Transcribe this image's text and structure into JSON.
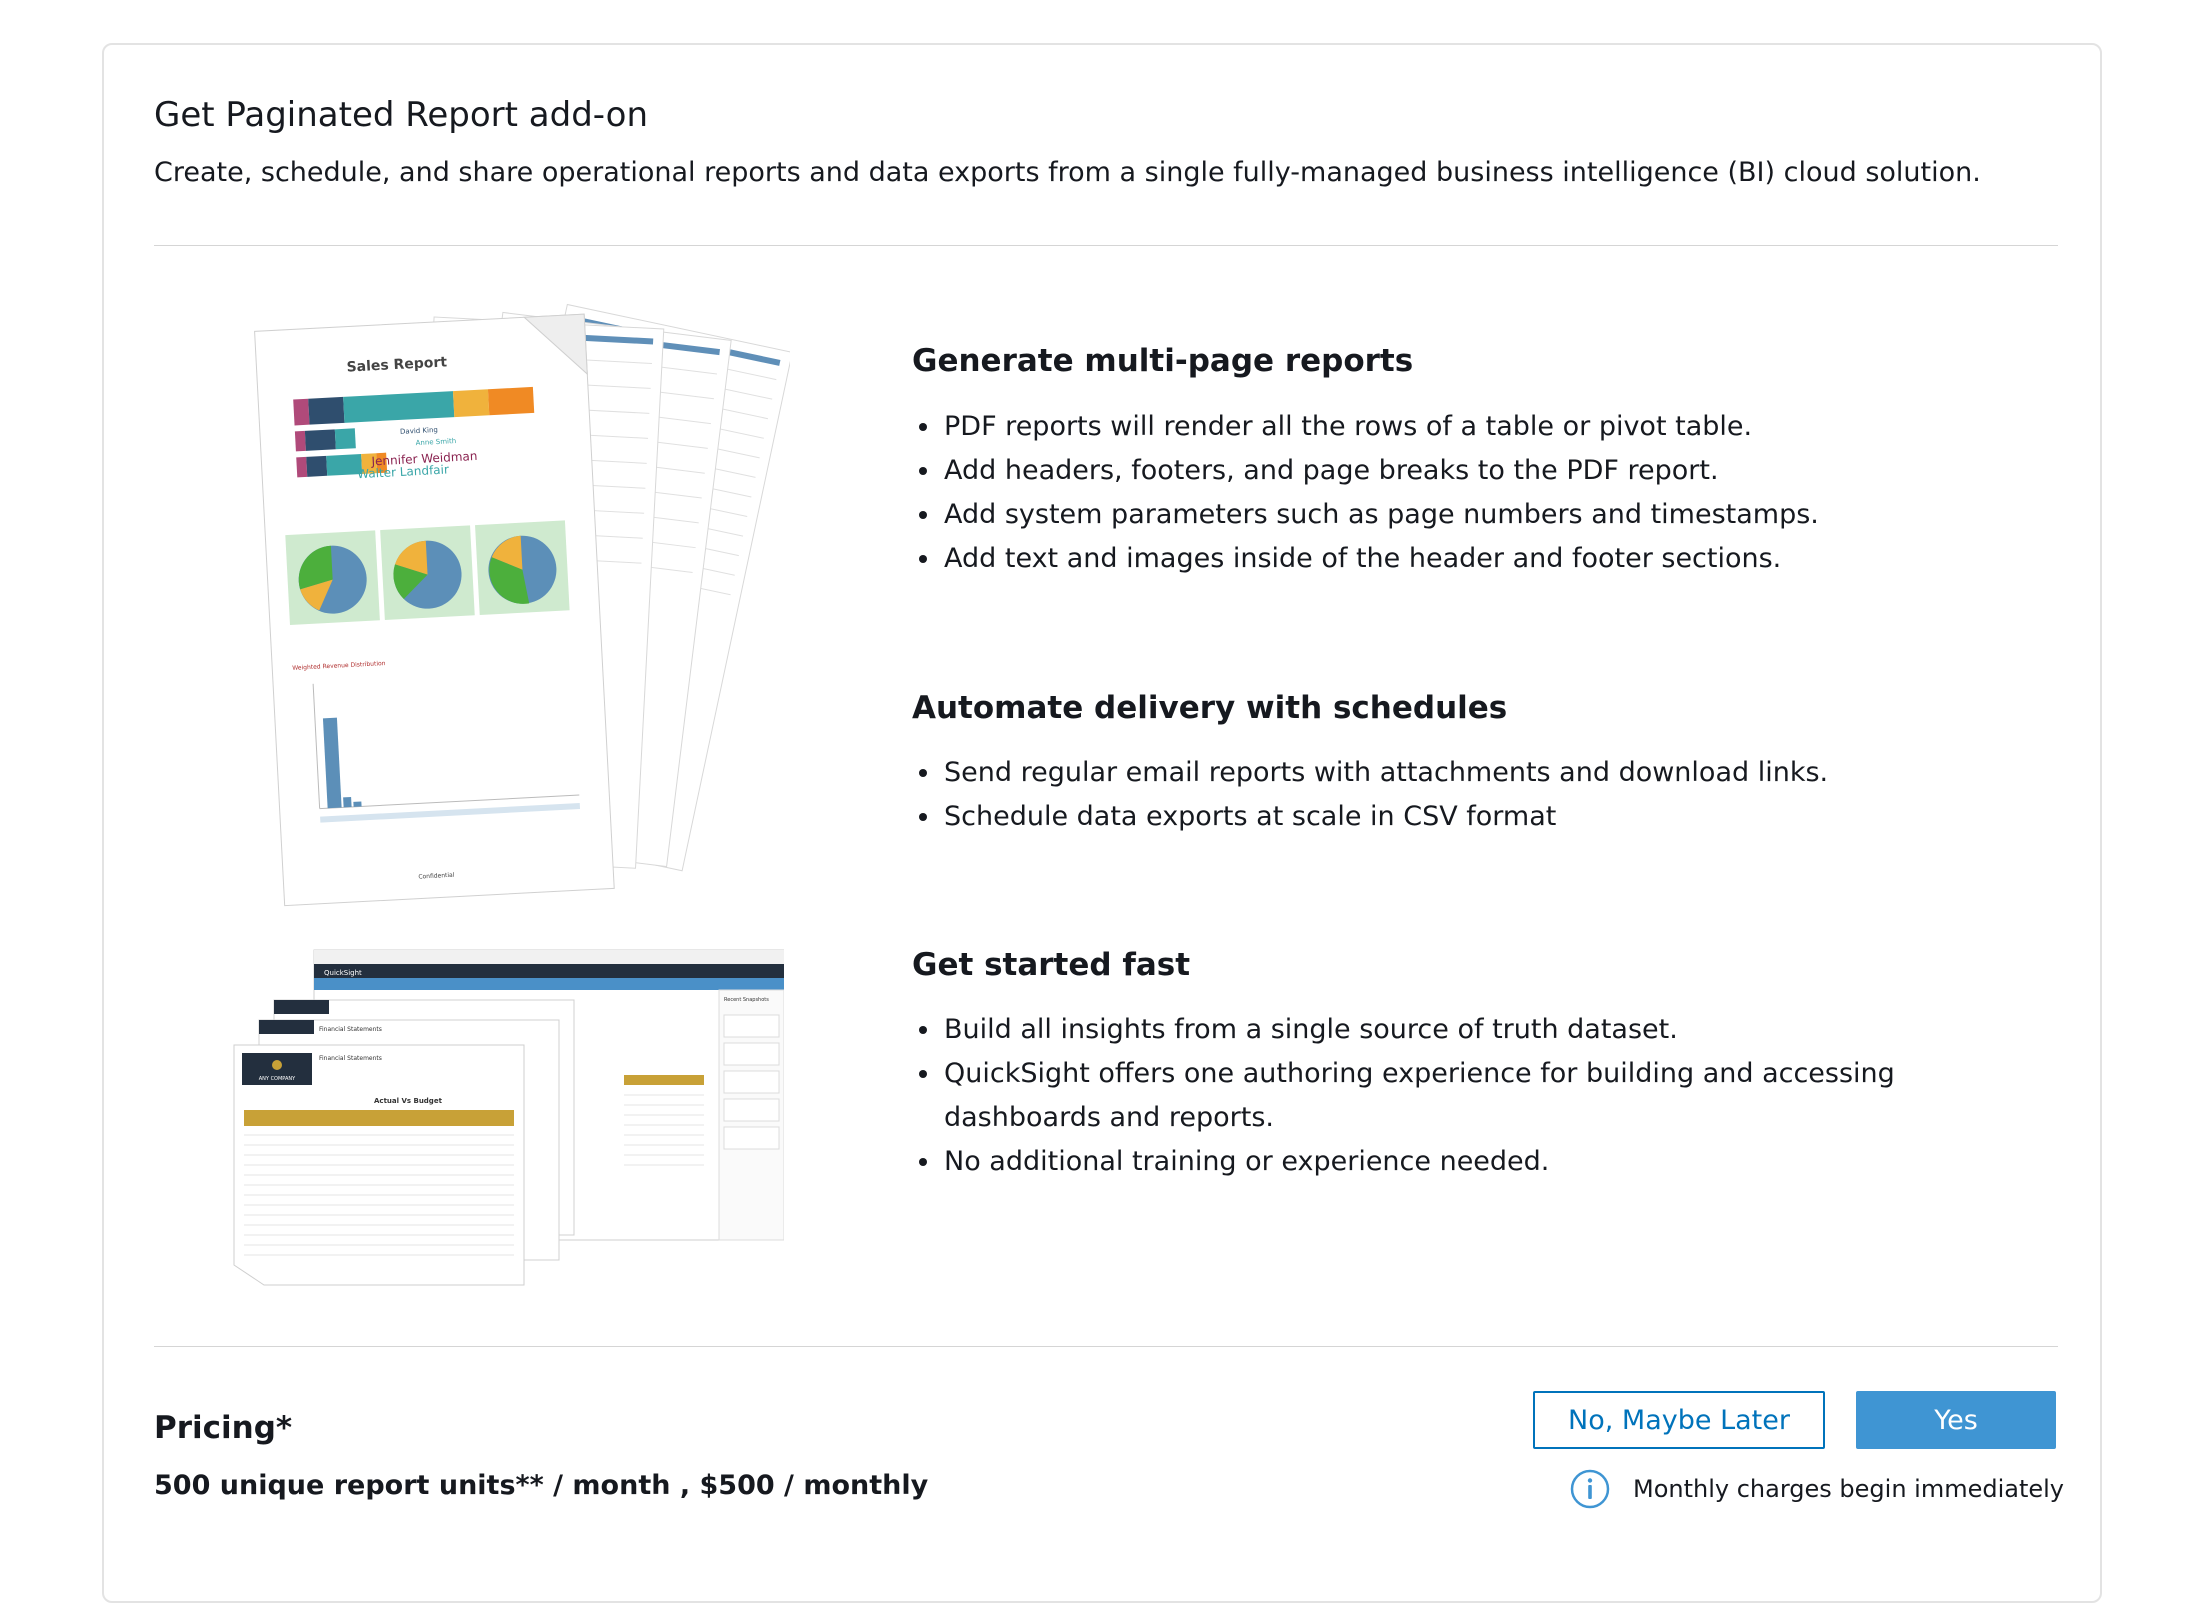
{
  "header": {
    "title": "Get Paginated Report add-on",
    "description": "Create, schedule, and share operational reports and data exports from a single fully-managed business intelligence (BI) cloud solution."
  },
  "sections": [
    {
      "title": "Generate multi-page reports",
      "bullets": [
        "PDF reports will render all the rows of a table or pivot table.",
        "Add headers, footers, and page breaks to the PDF report.",
        "Add system parameters such as page numbers and timestamps.",
        "Add text and images inside of the header and footer sections."
      ]
    },
    {
      "title": "Automate delivery with schedules",
      "bullets": [
        "Send regular email reports with attachments and download links.",
        "Schedule data exports at scale in CSV format"
      ]
    },
    {
      "title": "Get started fast",
      "bullets": [
        "Build all insights from a single source of truth dataset.",
        "QuickSight offers one authoring experience for building and accessing dashboards and reports.",
        "No additional training or experience needed."
      ]
    }
  ],
  "illustrations": {
    "sales_report_title": "Sales Report",
    "sales_report_names": [
      "David King",
      "Anne Smith",
      "Jennifer Weidman",
      "Walter Landfair"
    ],
    "sales_report_section": "Weighted Revenue Distribution",
    "sales_report_footer": "Confidential",
    "quicksight_app": "QuickSight",
    "quicksight_panel": "Recent Snapshots",
    "financial_title": "Financial Statements",
    "financial_subtitle": "Actual Vs Budget",
    "company_name": "ANY COMPANY"
  },
  "pricing": {
    "title": "Pricing*",
    "detail": "500 unique report units** / month , $500 / monthly"
  },
  "actions": {
    "no_label": "No, Maybe Later",
    "yes_label": "Yes",
    "notice": "Monthly charges begin immediately"
  },
  "colors": {
    "primary": "#0073bb",
    "yes_button": "#3f95d3",
    "accent_teal": "#3aa6a8",
    "accent_gold": "#c8a137"
  }
}
